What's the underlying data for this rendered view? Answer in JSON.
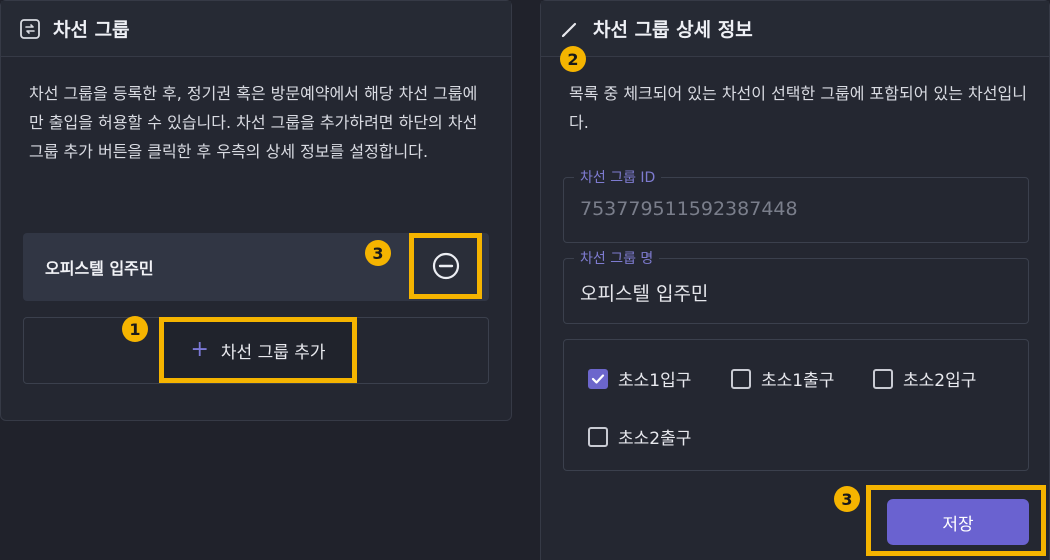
{
  "left_panel": {
    "title": "차선 그룹",
    "description": "차선 그룹을 등록한 후, 정기권 혹은 방문예약에서 해당 차선 그룹에만 출입을 허용할 수 있습니다. 차선 그룹을 추가하려면 하단의 차선 그룹 추가 버튼을 클릭한 후 우측의 상세 정보를 설정합니다.",
    "groups": [
      {
        "name": "오피스텔 입주민"
      }
    ],
    "add_button_label": "차선 그룹 추가",
    "add_button_icon": "plus-icon",
    "remove_button_icon": "minus-circle-icon"
  },
  "right_panel": {
    "title": "차선 그룹 상세 정보",
    "title_icon": "pencil-icon",
    "description": "목록 중 체크되어 있는 차선이 선택한 그룹에 포함되어 있는 차선입니다.",
    "fields": {
      "id_label": "차선 그룹 ID",
      "id_value": "753779511592387448",
      "name_label": "차선 그룹 명",
      "name_value": "오피스텔 입주민"
    },
    "lanes": [
      {
        "label": "초소1입구",
        "checked": true
      },
      {
        "label": "초소1출구",
        "checked": false
      },
      {
        "label": "초소2입구",
        "checked": false
      },
      {
        "label": "초소2출구",
        "checked": false
      }
    ],
    "save_label": "저장"
  },
  "annotations": {
    "add_step": "1",
    "detail_step": "2",
    "action_step": "3"
  },
  "colors": {
    "accent": "#6a62d0",
    "highlight": "#f5b400",
    "background": "#20222b"
  }
}
